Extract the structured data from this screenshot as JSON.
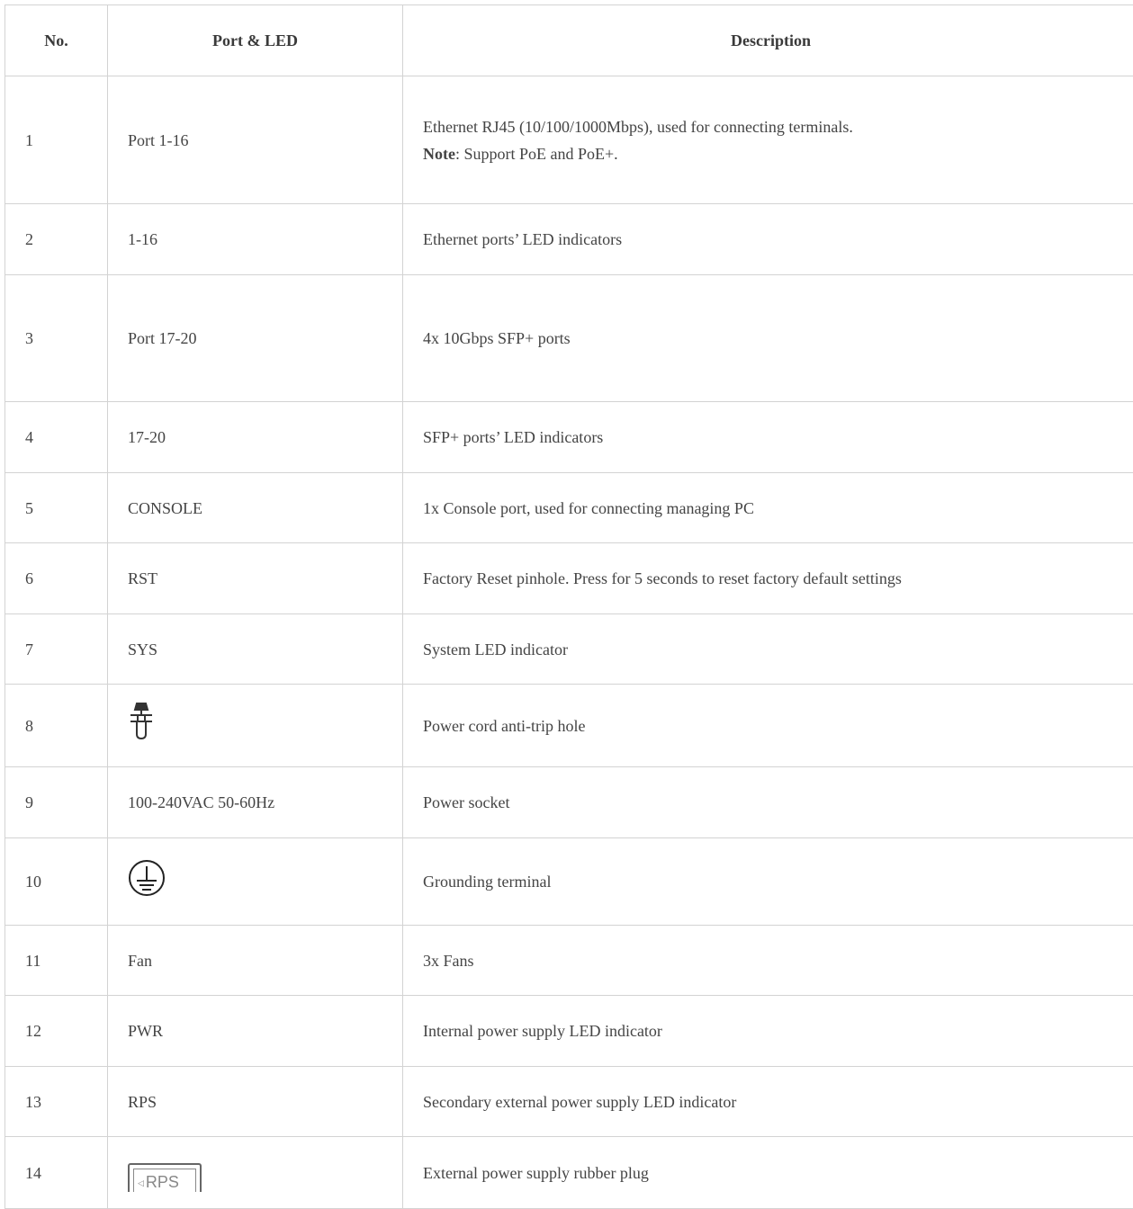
{
  "table": {
    "headers": [
      "No.",
      "Port & LED",
      "Description"
    ],
    "rows": [
      {
        "no": "1",
        "port": "Port 1-16",
        "desc": "Ethernet RJ45 (10/100/1000Mbps), used for connecting terminals.",
        "note_label": "Note",
        "note_text": ": Support PoE and PoE+."
      },
      {
        "no": "2",
        "port": "1-16",
        "desc": "Ethernet ports’ LED indicators"
      },
      {
        "no": "3",
        "port": "Port 17-20",
        "desc": "4x 10Gbps SFP+ ports"
      },
      {
        "no": "4",
        "port": "17-20",
        "desc": "SFP+ ports’ LED indicators"
      },
      {
        "no": "5",
        "port": "CONSOLE",
        "desc": "1x Console port, used for connecting managing PC"
      },
      {
        "no": "6",
        "port": "RST",
        "desc": "Factory Reset pinhole. Press for 5 seconds to reset factory default settings"
      },
      {
        "no": "7",
        "port": "SYS",
        "desc": "System LED indicator"
      },
      {
        "no": "8",
        "port_icon": "anti-trip-hole-icon",
        "desc": "Power cord anti-trip hole"
      },
      {
        "no": "9",
        "port": "100-240VAC 50-60Hz",
        "desc": "Power socket"
      },
      {
        "no": "10",
        "port_icon": "ground-icon",
        "desc": "Grounding terminal"
      },
      {
        "no": "11",
        "port": "Fan",
        "desc": "3x Fans"
      },
      {
        "no": "12",
        "port": "PWR",
        "desc": "Internal power supply LED indicator"
      },
      {
        "no": "13",
        "port": "RPS",
        "desc": "Secondary external power supply LED indicator"
      },
      {
        "no": "14",
        "port_icon": "rps-plug-icon",
        "port_icon_text": "RPS",
        "desc": "External power supply rubber plug"
      }
    ]
  }
}
